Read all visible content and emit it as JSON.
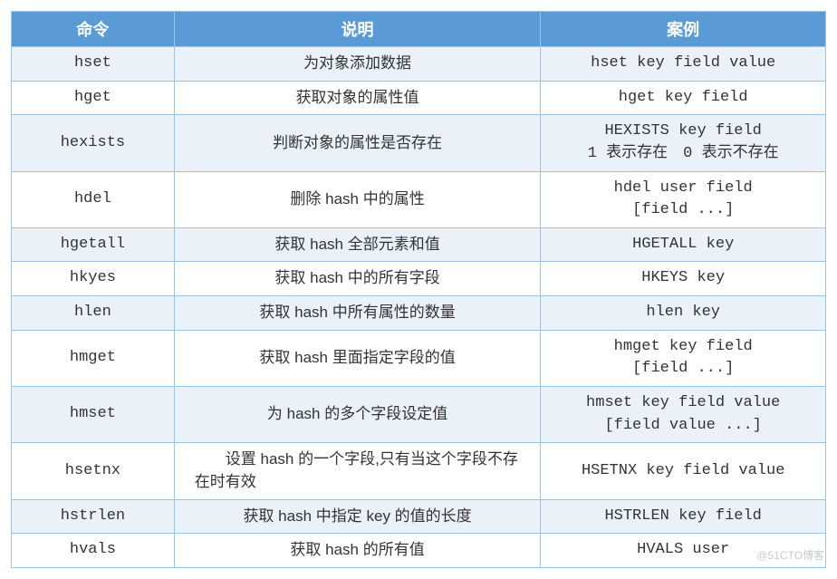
{
  "headers": [
    "命令",
    "说明",
    "案例"
  ],
  "rows": [
    {
      "cmd": "hset",
      "desc": "为对象添加数据",
      "descAlign": "center",
      "example": "hset key field value"
    },
    {
      "cmd": "hget",
      "desc": "获取对象的属性值",
      "descAlign": "center",
      "example": "hget key field"
    },
    {
      "cmd": "hexists",
      "desc": "判断对象的属性是否存在",
      "descAlign": "center",
      "example": "HEXISTS key field\n1 表示存在　0 表示不存在"
    },
    {
      "cmd": "hdel",
      "desc": "删除 hash 中的属性",
      "descAlign": "center",
      "example": "hdel user field\n[field ...]"
    },
    {
      "cmd": "hgetall",
      "desc": "获取 hash 全部元素和值",
      "descAlign": "center",
      "example": "HGETALL key"
    },
    {
      "cmd": "hkyes",
      "desc": "获取 hash 中的所有字段",
      "descAlign": "center",
      "example": "HKEYS key"
    },
    {
      "cmd": "hlen",
      "desc": "获取 hash 中所有属性的数量",
      "descAlign": "center",
      "example": "hlen key"
    },
    {
      "cmd": "hmget",
      "desc": "获取 hash 里面指定字段的值",
      "descAlign": "center",
      "example": "hmget key field\n[field ...]"
    },
    {
      "cmd": "hmset",
      "desc": "为 hash 的多个字段设定值",
      "descAlign": "center",
      "example": "hmset  key  field  value\n[field value ...]"
    },
    {
      "cmd": "hsetnx",
      "desc": "　　设置 hash 的一个字段,只有当这个字段不存在时有效",
      "descAlign": "left",
      "example": "HSETNX key field value"
    },
    {
      "cmd": "hstrlen",
      "desc": "获取 hash 中指定 key 的值的长度",
      "descAlign": "center",
      "example": "HSTRLEN key field"
    },
    {
      "cmd": "hvals",
      "desc": "获取 hash 的所有值",
      "descAlign": "center",
      "example": "HVALS user"
    }
  ],
  "watermark": "@51CTO博客",
  "chart_data": {
    "type": "table",
    "title": "",
    "columns": [
      "命令",
      "说明",
      "案例"
    ],
    "rows": [
      [
        "hset",
        "为对象添加数据",
        "hset key field value"
      ],
      [
        "hget",
        "获取对象的属性值",
        "hget key field"
      ],
      [
        "hexists",
        "判断对象的属性是否存在",
        "HEXISTS key field / 1 表示存在 0 表示不存在"
      ],
      [
        "hdel",
        "删除 hash 中的属性",
        "hdel user field [field ...]"
      ],
      [
        "hgetall",
        "获取 hash 全部元素和值",
        "HGETALL key"
      ],
      [
        "hkyes",
        "获取 hash 中的所有字段",
        "HKEYS key"
      ],
      [
        "hlen",
        "获取 hash 中所有属性的数量",
        "hlen key"
      ],
      [
        "hmget",
        "获取 hash 里面指定字段的值",
        "hmget key field [field ...]"
      ],
      [
        "hmset",
        "为 hash 的多个字段设定值",
        "hmset key field value [field value ...]"
      ],
      [
        "hsetnx",
        "设置 hash 的一个字段,只有当这个字段不存在时有效",
        "HSETNX key field value"
      ],
      [
        "hstrlen",
        "获取 hash 中指定 key 的值的长度",
        "HSTRLEN key field"
      ],
      [
        "hvals",
        "获取 hash 的所有值",
        "HVALS user"
      ]
    ]
  }
}
